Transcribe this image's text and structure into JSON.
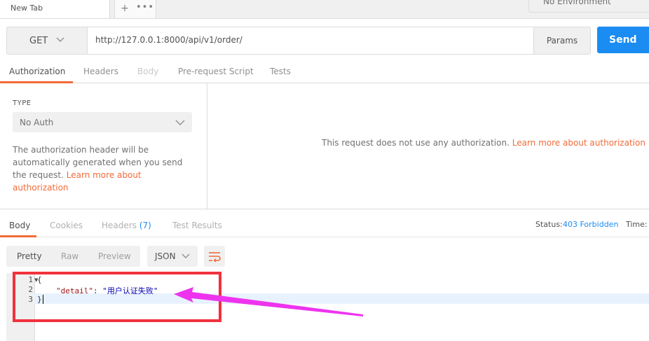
{
  "browser_tab": {
    "title": "New Tab",
    "add_symbol": "+",
    "more_symbol": "•••"
  },
  "environment": {
    "selected": "No Environment"
  },
  "request": {
    "method": "GET",
    "url": "http://127.0.0.1:8000/api/v1/order/",
    "params_label": "Params",
    "send_label": "Send"
  },
  "request_tabs": [
    "Authorization",
    "Headers",
    "Body",
    "Pre-request Script",
    "Tests"
  ],
  "auth": {
    "type_label": "TYPE",
    "type_value": "No Auth",
    "description": "The authorization header will be automatically generated when you send the request.",
    "link_text": "Learn more about authorization",
    "message": "This request does not use any authorization.",
    "message_link": "Learn more about authorization"
  },
  "response_tabs": {
    "body": "Body",
    "cookies": "Cookies",
    "headers": "Headers",
    "headers_count": "(7)",
    "test_results": "Test Results"
  },
  "status": {
    "label": "Status:",
    "value": "403 Forbidden",
    "time_label": "Time:"
  },
  "view_modes": [
    "Pretty",
    "Raw",
    "Preview"
  ],
  "format": "JSON",
  "code": {
    "line_numbers": [
      "1",
      "2",
      "3"
    ],
    "open_brace": "{",
    "key": "\"detail\"",
    "colon": ": ",
    "value": "\"用户认证失败\"",
    "close_brace": "}"
  },
  "colors": {
    "accent": "#f26b3a",
    "send_blue": "#1a8cf2",
    "annotation_red": "#f1323c",
    "annotation_arrow": "#ee33ee"
  }
}
